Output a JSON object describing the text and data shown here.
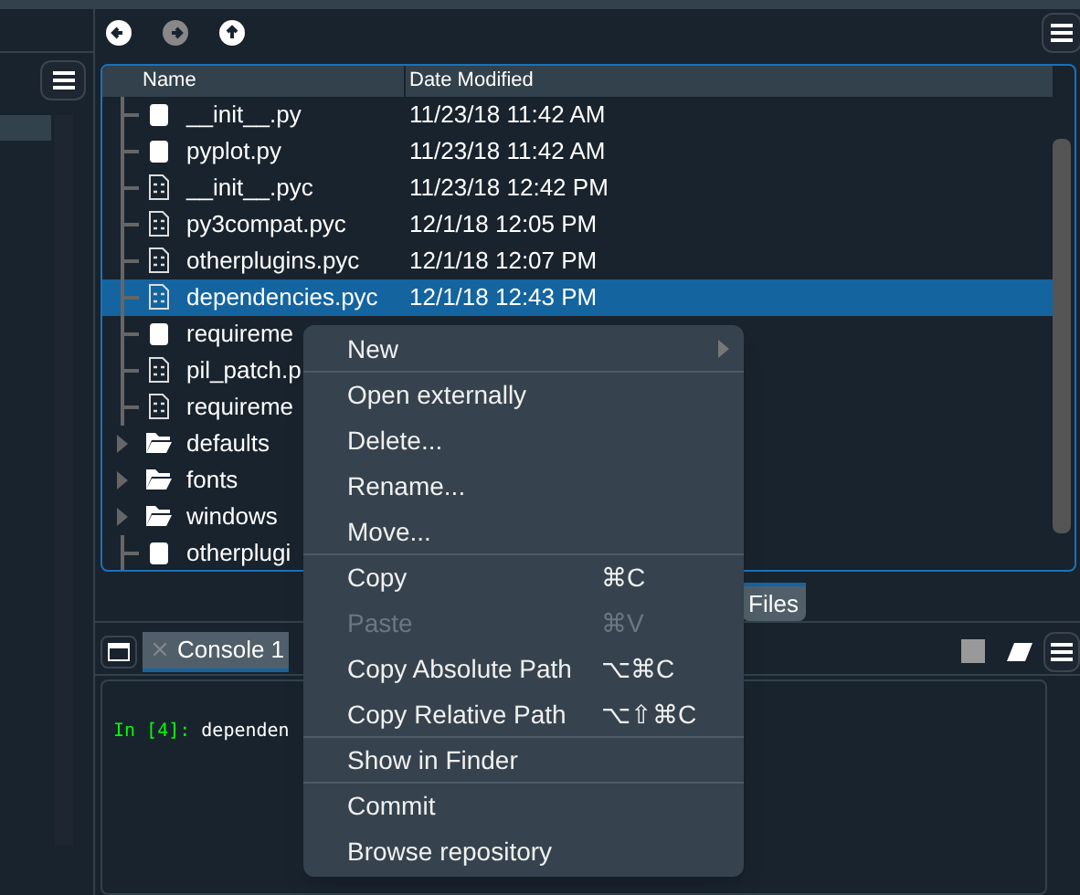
{
  "file_explorer": {
    "columns": [
      "Name",
      "Date Modified"
    ],
    "rows": [
      {
        "kind": "python",
        "name": "__init__.py",
        "date": "11/23/18 11:42 AM",
        "selected": false
      },
      {
        "kind": "python",
        "name": "pyplot.py",
        "date": "11/23/18 11:42 AM",
        "selected": false
      },
      {
        "kind": "binary",
        "name": "__init__.pyc",
        "date": "11/23/18 12:42 PM",
        "selected": false
      },
      {
        "kind": "binary",
        "name": "py3compat.pyc",
        "date": "12/1/18 12:05 PM",
        "selected": false
      },
      {
        "kind": "binary",
        "name": "otherplugins.pyc",
        "date": "12/1/18 12:07 PM",
        "selected": false
      },
      {
        "kind": "binary",
        "name": "dependencies.pyc",
        "date": "12/1/18 12:43 PM",
        "selected": true
      },
      {
        "kind": "python",
        "name": "requireme",
        "selected": false
      },
      {
        "kind": "binary",
        "name": "pil_patch.p",
        "selected": false
      },
      {
        "kind": "binary",
        "name": "requireme",
        "selected": false
      },
      {
        "kind": "folder",
        "name": "defaults",
        "selected": false
      },
      {
        "kind": "folder",
        "name": "fonts",
        "selected": false
      },
      {
        "kind": "folder",
        "name": "windows",
        "selected": false
      },
      {
        "kind": "python",
        "name": "otherplugi",
        "selected": false
      }
    ]
  },
  "pane_tabs": [
    {
      "label": "Files",
      "selected": true
    }
  ],
  "console": {
    "tab": "Console 1",
    "prompt": "In [4]:",
    "input": "dependen"
  },
  "context_menu": [
    {
      "label": "New",
      "submenu": true,
      "disabled": false,
      "separator_after": true
    },
    {
      "label": "Open externally",
      "disabled": false
    },
    {
      "label": "Delete...",
      "disabled": false
    },
    {
      "label": "Rename...",
      "disabled": false
    },
    {
      "label": "Move...",
      "disabled": false,
      "separator_after": true
    },
    {
      "label": "Copy",
      "shortcut": "⌘C",
      "disabled": false
    },
    {
      "label": "Paste",
      "shortcut": "⌘V",
      "disabled": true
    },
    {
      "label": "Copy Absolute Path",
      "shortcut": "⌥⌘C",
      "disabled": false
    },
    {
      "label": "Copy Relative Path",
      "shortcut": "⌥⇧⌘C",
      "disabled": false,
      "separator_after": true
    },
    {
      "label": "Show in Finder",
      "disabled": false,
      "separator_after": true
    },
    {
      "label": "Commit",
      "disabled": false
    },
    {
      "label": "Browse repository",
      "disabled": false
    }
  ]
}
